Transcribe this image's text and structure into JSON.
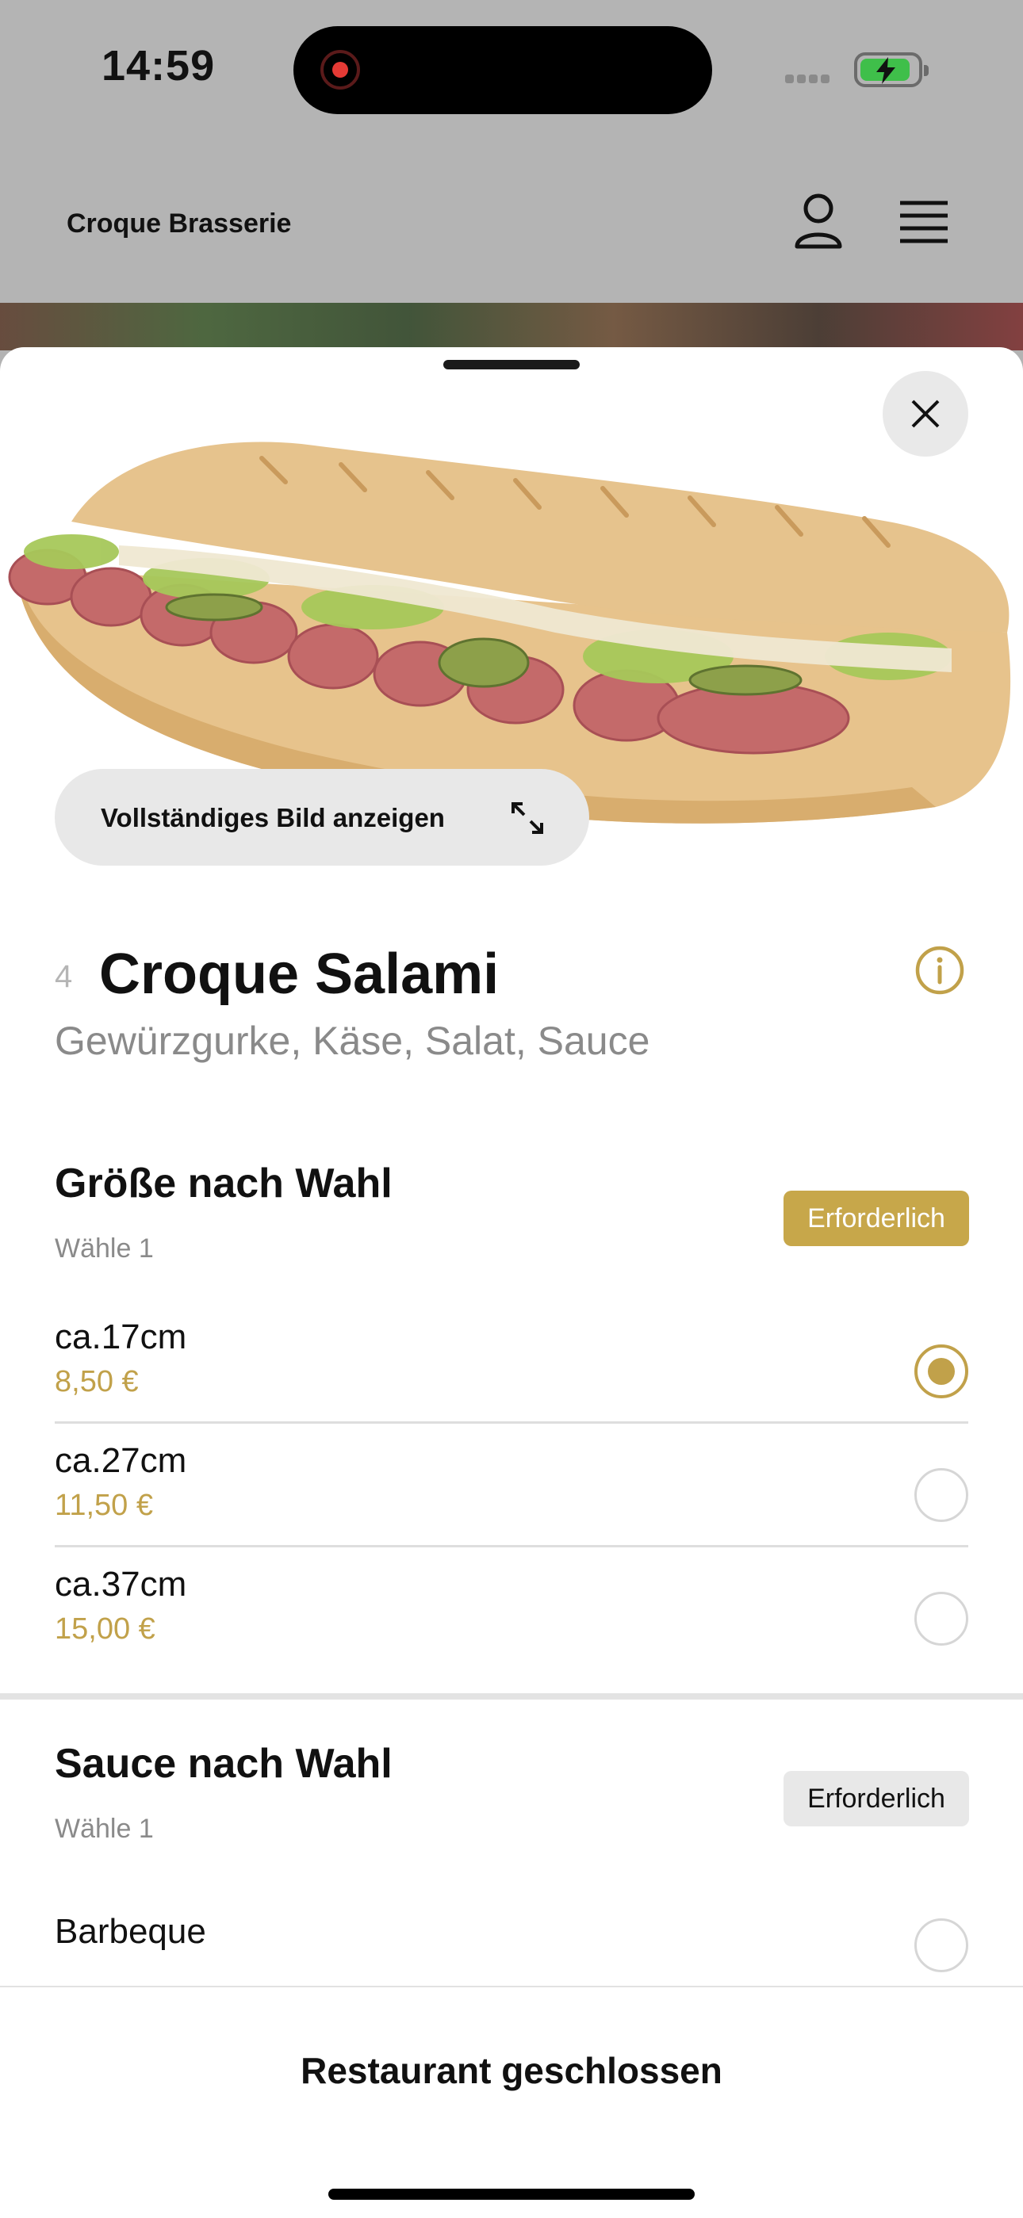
{
  "status_bar": {
    "time": "14:59"
  },
  "header": {
    "brand": "Croque Brasserie"
  },
  "sheet": {
    "full_image_label": "Vollständiges Bild anzeigen",
    "item": {
      "number": "4",
      "name": "Croque Salami",
      "description": "Gewürzgurke, Käse, Salat, Sauce"
    },
    "groups": [
      {
        "title": "Größe nach Wahl",
        "hint": "Wähle 1",
        "badge": "Erforderlich",
        "options": [
          {
            "name": "ca.17cm",
            "price": "8,50 €",
            "selected": true
          },
          {
            "name": "ca.27cm",
            "price": "11,50 €",
            "selected": false
          },
          {
            "name": "ca.37cm",
            "price": "15,00 €",
            "selected": false
          }
        ]
      },
      {
        "title": "Sauce nach Wahl",
        "hint": "Wähle 1",
        "badge": "Erforderlich",
        "options": [
          {
            "name": "Barbeque",
            "selected": false
          }
        ]
      }
    ]
  },
  "footer": {
    "label": "Restaurant geschlossen"
  },
  "colors": {
    "accent": "#c1a14a",
    "badge_gold": "#c7a74a",
    "overlay": "#b4b4b4"
  }
}
